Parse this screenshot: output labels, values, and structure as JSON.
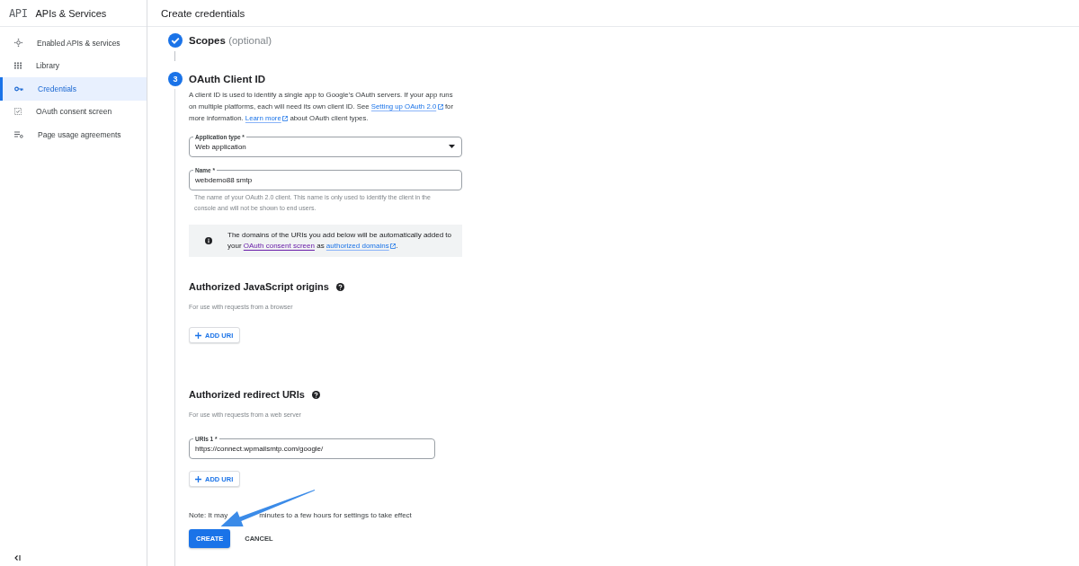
{
  "sidebar": {
    "logo": "API",
    "title": "APIs & Services",
    "items": [
      {
        "label": "Enabled APIs & services",
        "selected": false
      },
      {
        "label": "Library",
        "selected": false
      },
      {
        "label": "Credentials",
        "selected": true
      },
      {
        "label": "OAuth consent screen",
        "selected": false
      },
      {
        "label": "Page usage agreements",
        "selected": false
      }
    ]
  },
  "header": {
    "title": "Create credentials"
  },
  "steps": [
    {
      "kind": "done",
      "title": "Scopes",
      "suffix": "(optional)"
    },
    {
      "kind": "current",
      "number": "3",
      "title": "OAuth Client ID"
    }
  ],
  "description": [
    {
      "text": "A client ID is used to identify a single app to Google's OAuth servers. If your app runs on multiple platforms, each will need its own client ID. See "
    },
    {
      "link": "Setting up OAuth 2.0",
      "external": true,
      "visited": false
    },
    {
      "text": " for more information. "
    },
    {
      "link": "Learn more",
      "external": true,
      "visited": false
    },
    {
      "text": " about OAuth client types."
    }
  ],
  "fields": [
    {
      "kind": "select",
      "label": "Application type *",
      "value": "Web application"
    },
    {
      "kind": "text",
      "label": "Name *",
      "value": "webdemo88 smtp",
      "helper": "The name of your OAuth 2.0 client. This name is only used to identify the client in the console and will not be shown to end users."
    }
  ],
  "notice": [
    {
      "text": "The domains of the URIs you add below will be automatically added to your "
    },
    {
      "link": "OAuth consent screen",
      "external": false,
      "visited": true
    },
    {
      "text": " as "
    },
    {
      "link": "authorized domains",
      "external": true,
      "visited": false
    },
    {
      "text": "."
    }
  ],
  "sections": [
    {
      "title": "Authorized JavaScript origins",
      "hint": "For use with requests from a browser",
      "add_button": "ADD URI"
    },
    {
      "title": "Authorized redirect URIs",
      "hint": "For use with requests from a web server",
      "uris": [
        {
          "label": "URIs 1 *",
          "value": "https://connect.wpmailsmtp.com/google/"
        }
      ],
      "add_button": "ADD URI"
    }
  ],
  "note": [
    "Note: It may",
    "minutes to a few hours for settings to take effect"
  ],
  "actions": [
    {
      "label": "CREATE",
      "kind": "primary"
    },
    {
      "label": "CANCEL",
      "kind": "text"
    }
  ]
}
